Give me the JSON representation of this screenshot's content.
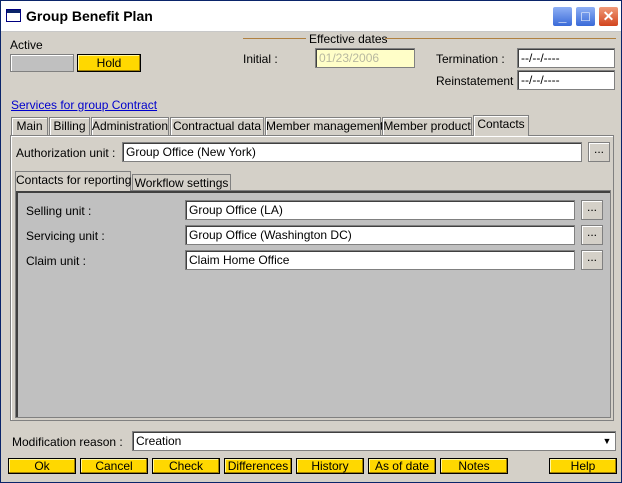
{
  "window": {
    "title": "Group Benefit Plan",
    "min_glyph": "_",
    "max_glyph": "□",
    "close_glyph": "✕"
  },
  "status": {
    "label": "Active",
    "hold_label": "Hold"
  },
  "effective_dates": {
    "legend": "Effective dates",
    "initial_label": "Initial :",
    "initial_value": "01/23/2006",
    "termination_label": "Termination :",
    "termination_value": "--/--/----",
    "reinstatement_label": "Reinstatement :",
    "reinstatement_value": "--/--/----"
  },
  "services_link": "Services for group Contract",
  "tabs": [
    "Main",
    "Billing",
    "Administration",
    "Contractual data",
    "Member management",
    "Member product",
    "Contacts"
  ],
  "active_tab": "Contacts",
  "authorization": {
    "label": "Authorization unit :",
    "value": "Group Office (New York)"
  },
  "subtabs": [
    "Contacts for reporting",
    "Workflow settings"
  ],
  "active_subtab": "Contacts for reporting",
  "units": {
    "selling_label": "Selling unit :",
    "selling_value": "Group Office (LA)",
    "servicing_label": "Servicing unit :",
    "servicing_value": "Group Office (Washington DC)",
    "claim_label": "Claim unit :",
    "claim_value": "Claim Home Office"
  },
  "browse_label": "...",
  "modification": {
    "label": "Modification reason :",
    "value": "Creation",
    "arrow": "▼"
  },
  "buttons": {
    "ok": "Ok",
    "cancel": "Cancel",
    "check": "Check",
    "differences": "Differences",
    "history": "History",
    "as_of_date": "As of date",
    "notes": "Notes",
    "help": "Help"
  },
  "colors": {
    "accent_yellow": "#ffd800",
    "window_bg": "#d4d0c8",
    "disabled_field": "#fffec8",
    "link": "#0000cc"
  }
}
